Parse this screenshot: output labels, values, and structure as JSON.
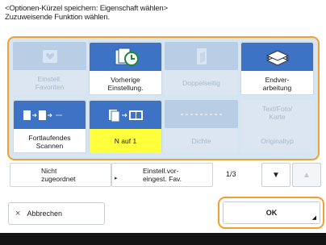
{
  "header": {
    "line1": "<Optionen-Kürzel speichern: Eigenschaft wählen>",
    "line2": "Zuzuweisende Funktion wählen."
  },
  "tiles": [
    {
      "label": "Einstell.\nFavoriten",
      "icon": "favorites-icon",
      "enabled": false
    },
    {
      "label": "Vorherige\nEinstellung.",
      "icon": "previous-settings-icon",
      "enabled": true
    },
    {
      "label": "Doppelseitig",
      "icon": "duplex-icon",
      "enabled": false
    },
    {
      "label": "Endver-\narbeitung",
      "icon": "finishing-icon",
      "enabled": true
    },
    {
      "label": "Fortlaufendes\nScannen",
      "icon": "continuous-scan-icon",
      "enabled": true
    },
    {
      "label": "N auf 1",
      "icon": "n-on-1-icon",
      "enabled": true,
      "highlight": "#ffff3c"
    },
    {
      "label": "Dichte",
      "icon": "density-icon",
      "enabled": false
    },
    {
      "label": "Text/Foto/\nKarte",
      "icon": "text-photo-map-icon",
      "enabled": false
    }
  ],
  "tile_extra": {
    "original_type": "Originaltyp"
  },
  "slots": {
    "not_assigned": "Nicht\nzugeordnet",
    "preset_fav": "Einstell.vor-\neingest. Fav."
  },
  "pager": {
    "text": "1/3",
    "down": "▼",
    "up": "▲"
  },
  "buttons": {
    "cancel": "Abbrechen",
    "cancel_icon": "×",
    "ok": "OK"
  },
  "colors": {
    "accent": "#f0a030",
    "tile_blue": "#3d72c4",
    "highlight": "#ffff3c",
    "panel": "#d6e5f2"
  }
}
